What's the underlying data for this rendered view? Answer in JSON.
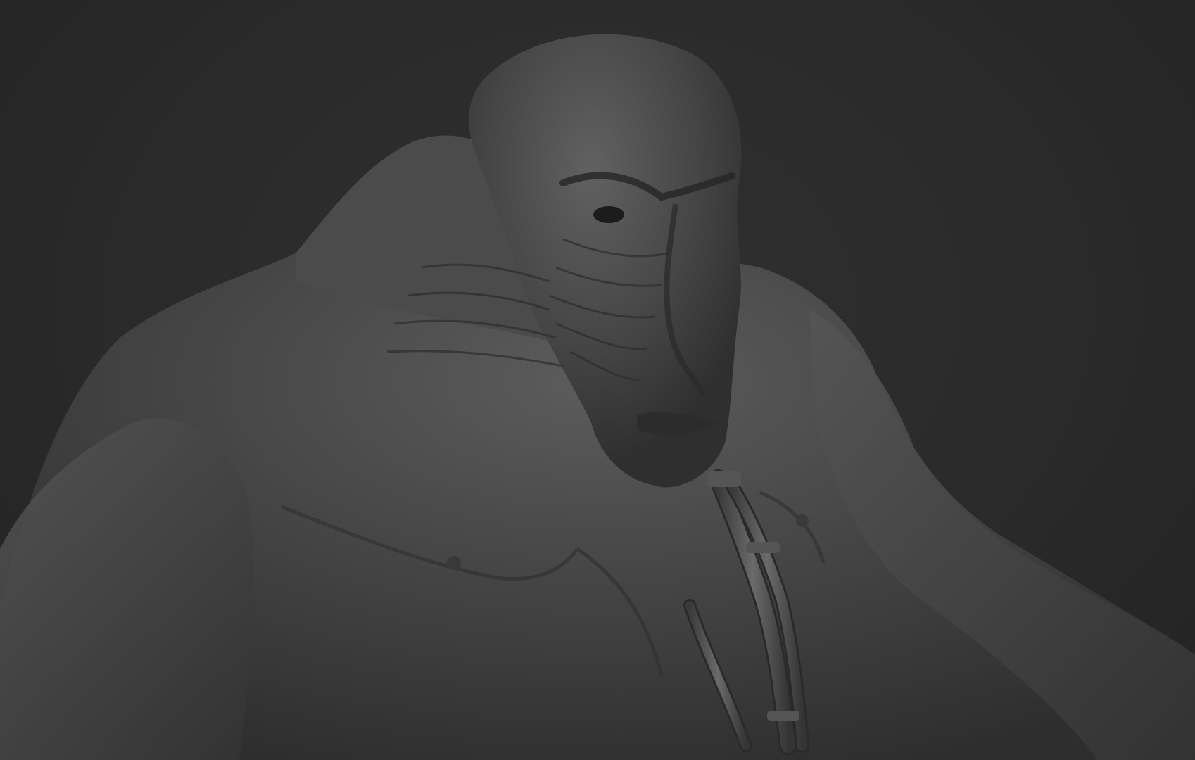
{
  "scene": {
    "subject": "sculpted-creature-bust",
    "background_color": "#2b2b2b",
    "material_color": "#4a4a4a"
  }
}
